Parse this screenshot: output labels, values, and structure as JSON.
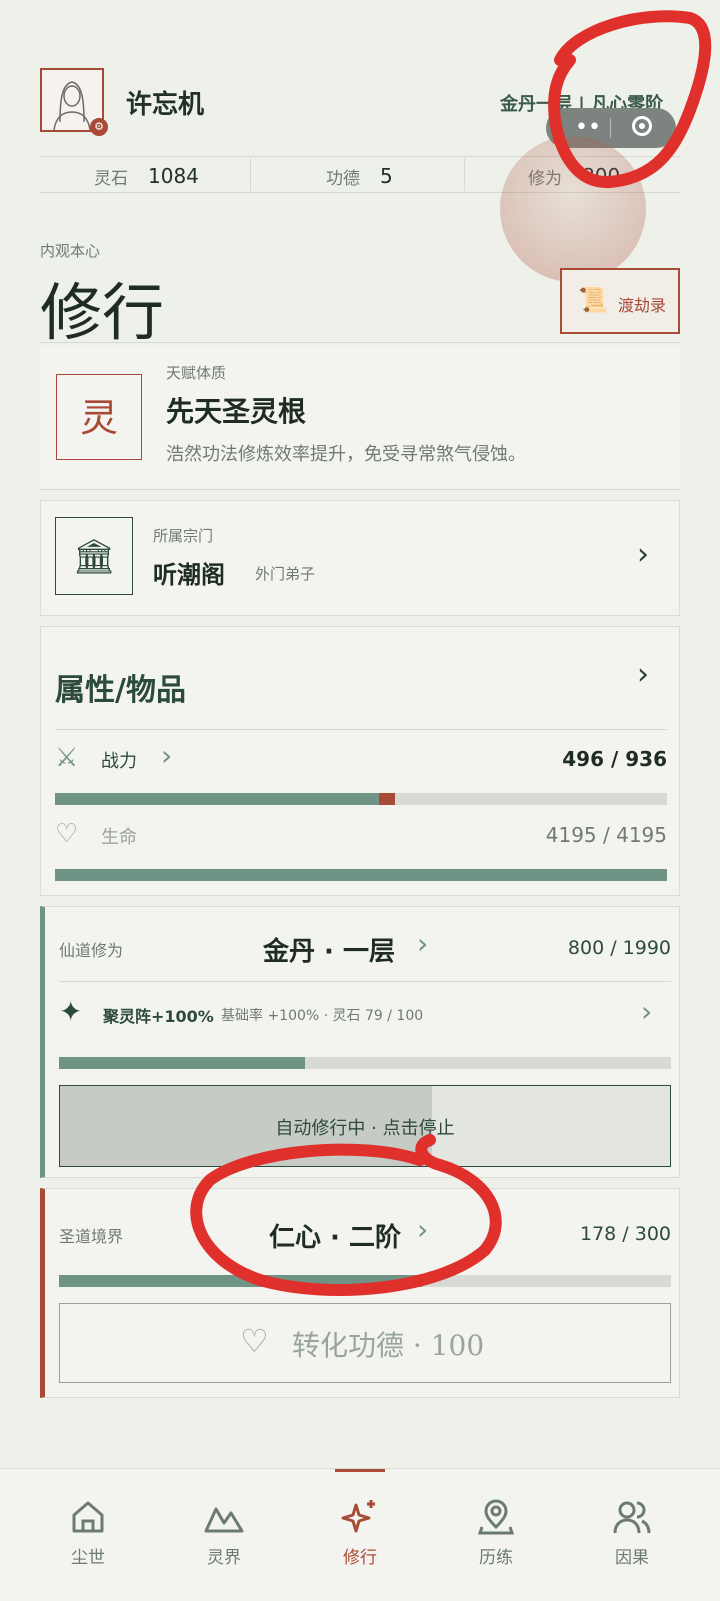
{
  "header": {
    "name": "许忘机",
    "realm_right": "金丹一层 | 凡心零阶",
    "stats": [
      {
        "label": "灵石",
        "value": "1084"
      },
      {
        "label": "功德",
        "value": "5"
      },
      {
        "label": "修为",
        "value": "800"
      }
    ]
  },
  "page": {
    "subtitle": "内观本心",
    "title": "修行",
    "record_button": "渡劫录"
  },
  "talent": {
    "glyph": "灵",
    "label": "天赋体质",
    "name": "先天圣灵根",
    "desc": "浩然功法修炼效率提升，免受寻常煞气侵蚀。"
  },
  "sect": {
    "label": "所属宗门",
    "name": "听潮阁",
    "rank": "外门弟子"
  },
  "attributes": {
    "title": "属性/物品",
    "power_label": "战力",
    "power_value": "496 / 936",
    "power_fraction": 0.53,
    "life_label": "生命",
    "life_value": "4195 / 4195",
    "life_fraction": 1.0
  },
  "cultivation": {
    "label": "仙道修为",
    "realm": "金丹 · 一层",
    "value": "800 / 1990",
    "fraction": 0.402,
    "array_name": "聚灵阵+100%",
    "array_detail": "基础率 +100% · 灵石 79 / 100",
    "auto_button": "自动修行中 · 点击停止"
  },
  "sage": {
    "label": "圣道境界",
    "realm": "仁心 · 二阶",
    "value": "178 / 300",
    "fraction": 0.593,
    "convert_button": "转化功德 · 100"
  },
  "nav": [
    {
      "label": "尘世",
      "icon": "home-icon"
    },
    {
      "label": "灵界",
      "icon": "mountain-icon"
    },
    {
      "label": "修行",
      "icon": "sparkle-icon"
    },
    {
      "label": "历练",
      "icon": "map-pin-icon"
    },
    {
      "label": "因果",
      "icon": "people-icon"
    }
  ],
  "colors": {
    "accent_red": "#a94a37",
    "accent_green": "#6f9384",
    "annotation_red": "#e0302c"
  }
}
